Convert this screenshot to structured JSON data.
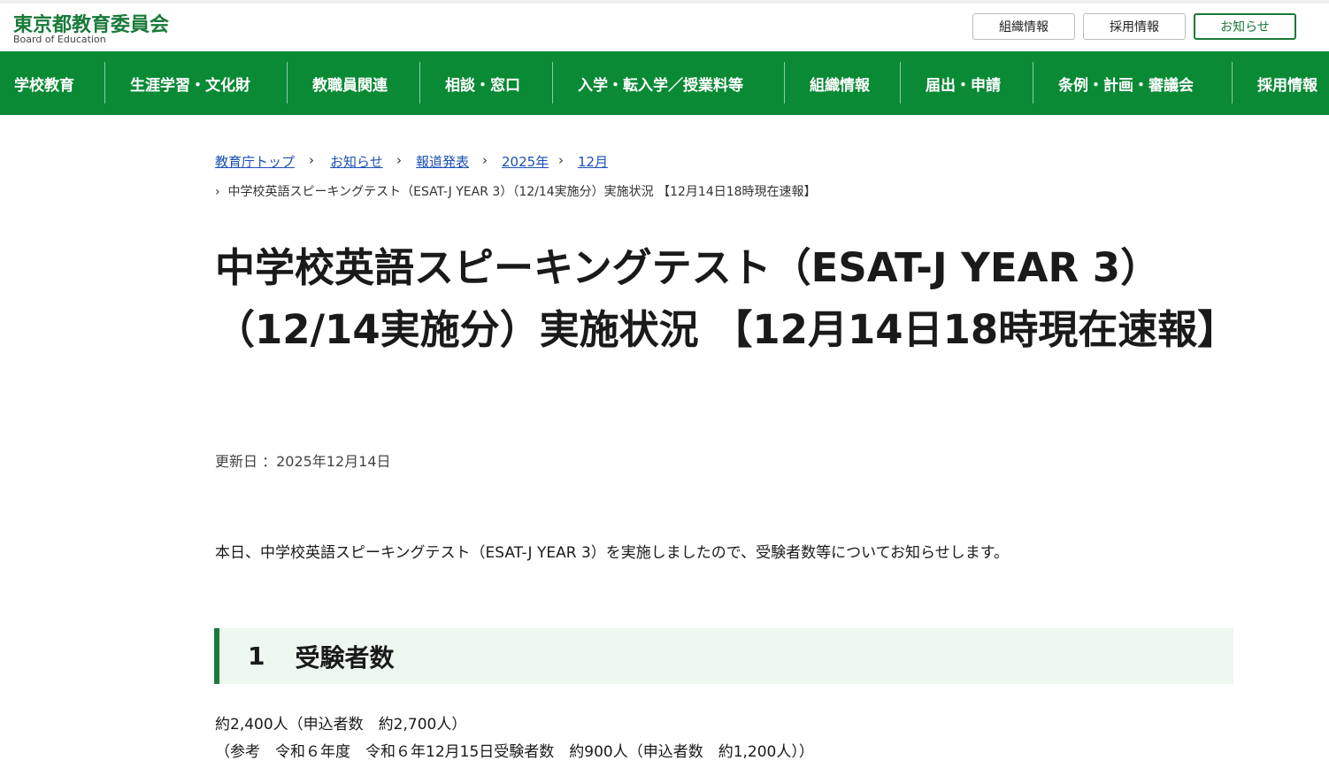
{
  "header": {
    "logo_ja": "東京都教育委員会",
    "logo_en": "Board of Education",
    "utility_links": [
      "組織情報",
      "採用情報",
      "お知らせ"
    ]
  },
  "nav": {
    "items": [
      "学校教育",
      "生涯学習・文化財",
      "教職員関連",
      "相談・窓口",
      "入学・転入学／授業料等",
      "組織情報",
      "届出・申請",
      "条例・計画・審議会",
      "採用情報"
    ]
  },
  "breadcrumb": {
    "items": [
      "教育庁トップ",
      "お知らせ",
      "報道発表",
      "2025年",
      "12月"
    ],
    "current": "中学校英語スピーキングテスト（ESAT-J YEAR 3）（12/14実施分）実施状況 【12月14日18時現在速報】",
    "separator": "›"
  },
  "page": {
    "title": "中学校英語スピーキングテスト（ESAT-J YEAR 3）（12/14実施分）実施状況 【12月14日18時現在速報】",
    "updated": "更新日 ：2025年12月14日",
    "intro": "本日、中学校英語スピーキングテスト（ESAT-J YEAR 3）を実施しましたので、受験者数等についてお知らせします。"
  },
  "section1": {
    "number": "1",
    "heading": "受験者数",
    "line1": "約2,400人（申込者数　約2,700人）",
    "line2": "（参考　令和６年度　令和６年12月15日受験者数　約900人（申込者数　約1,200人））"
  },
  "colors": {
    "brand_green": "#0a8a35",
    "logo_green": "#1a7a3a",
    "heading_bg": "#eef6f0",
    "link_blue": "#1a4fb5"
  }
}
